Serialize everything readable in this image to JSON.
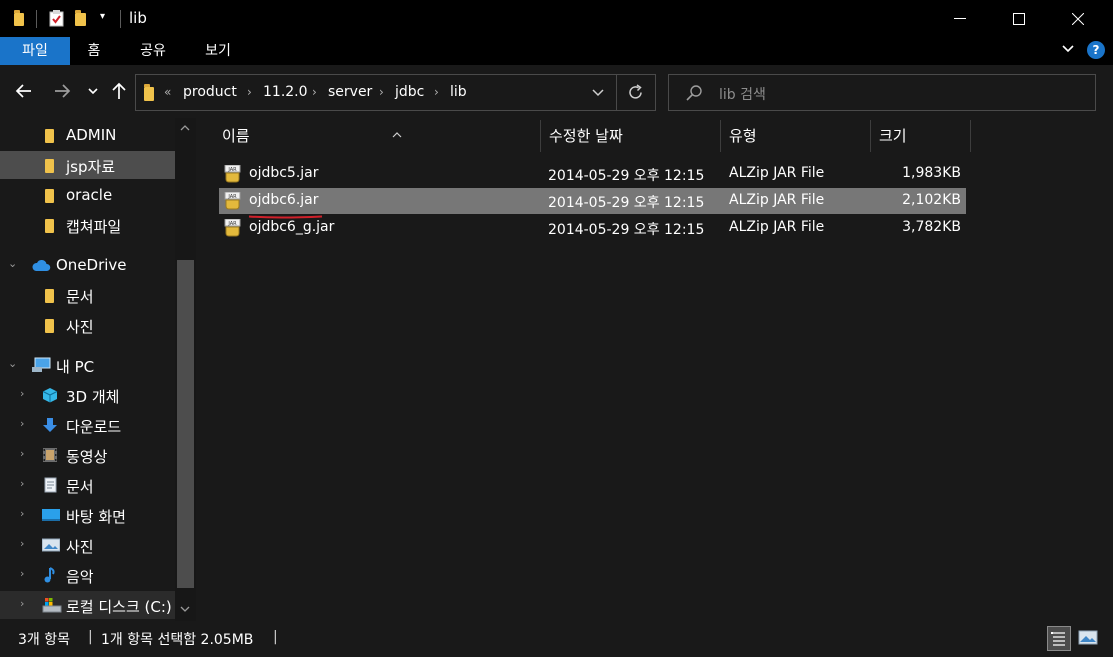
{
  "window": {
    "title": "lib",
    "controls": {
      "minimize": "—",
      "maximize": "☐",
      "close": "✕"
    }
  },
  "ribbon": {
    "tabs": [
      {
        "label": "파일",
        "active": true
      },
      {
        "label": "홈"
      },
      {
        "label": "공유"
      },
      {
        "label": "보기"
      }
    ]
  },
  "address": {
    "overflow": "«",
    "crumbs": [
      "product",
      "11.2.0",
      "server",
      "jdbc",
      "lib"
    ]
  },
  "search": {
    "placeholder": "lib 검색"
  },
  "sidebar": {
    "items": [
      {
        "label": "ADMIN",
        "icon": "folder-icon",
        "selected": false
      },
      {
        "label": "jsp자료",
        "icon": "folder-icon",
        "selected": true
      },
      {
        "label": "oracle",
        "icon": "folder-icon",
        "selected": false
      },
      {
        "label": "캡쳐파일",
        "icon": "folder-icon",
        "selected": false
      },
      {
        "label": "OneDrive",
        "icon": "cloud-icon",
        "selected": false,
        "expander": true
      },
      {
        "label": "문서",
        "icon": "folder-icon",
        "selected": false
      },
      {
        "label": "사진",
        "icon": "folder-icon",
        "selected": false
      },
      {
        "label": "내 PC",
        "icon": "computer-icon",
        "selected": false,
        "expander": true
      },
      {
        "label": "3D 개체",
        "icon": "cube-icon",
        "selected": false,
        "expander": true
      },
      {
        "label": "다운로드",
        "icon": "download-icon",
        "selected": false,
        "expander": true
      },
      {
        "label": "동영상",
        "icon": "video-icon",
        "selected": false,
        "expander": true
      },
      {
        "label": "문서",
        "icon": "document-icon",
        "selected": false,
        "expander": true
      },
      {
        "label": "바탕 화면",
        "icon": "desktop-icon",
        "selected": false,
        "expander": true
      },
      {
        "label": "사진",
        "icon": "picture-icon",
        "selected": false,
        "expander": true
      },
      {
        "label": "음악",
        "icon": "music-icon",
        "selected": false,
        "expander": true
      },
      {
        "label": "로컬 디스크 (C:)",
        "icon": "drive-icon",
        "selected": false,
        "expander": true
      }
    ]
  },
  "columns": {
    "name": "이름",
    "modified": "수정한 날짜",
    "type": "유형",
    "size": "크기"
  },
  "files": [
    {
      "name": "ojdbc5.jar",
      "modified": "2014-05-29 오후 12:15",
      "type": "ALZip JAR File",
      "size": "1,983KB",
      "selected": false
    },
    {
      "name": "ojdbc6.jar",
      "modified": "2014-05-29 오후 12:15",
      "type": "ALZip JAR File",
      "size": "2,102KB",
      "selected": true
    },
    {
      "name": "ojdbc6_g.jar",
      "modified": "2014-05-29 오후 12:15",
      "type": "ALZip JAR File",
      "size": "3,782KB",
      "selected": false
    }
  ],
  "status": {
    "count": "3개 항목",
    "selection": "1개 항목 선택함 2.05MB"
  },
  "colors": {
    "accent": "#1a74c9",
    "folder": "#f0c24b",
    "selection": "#777777",
    "annotation": "#d0202a"
  }
}
